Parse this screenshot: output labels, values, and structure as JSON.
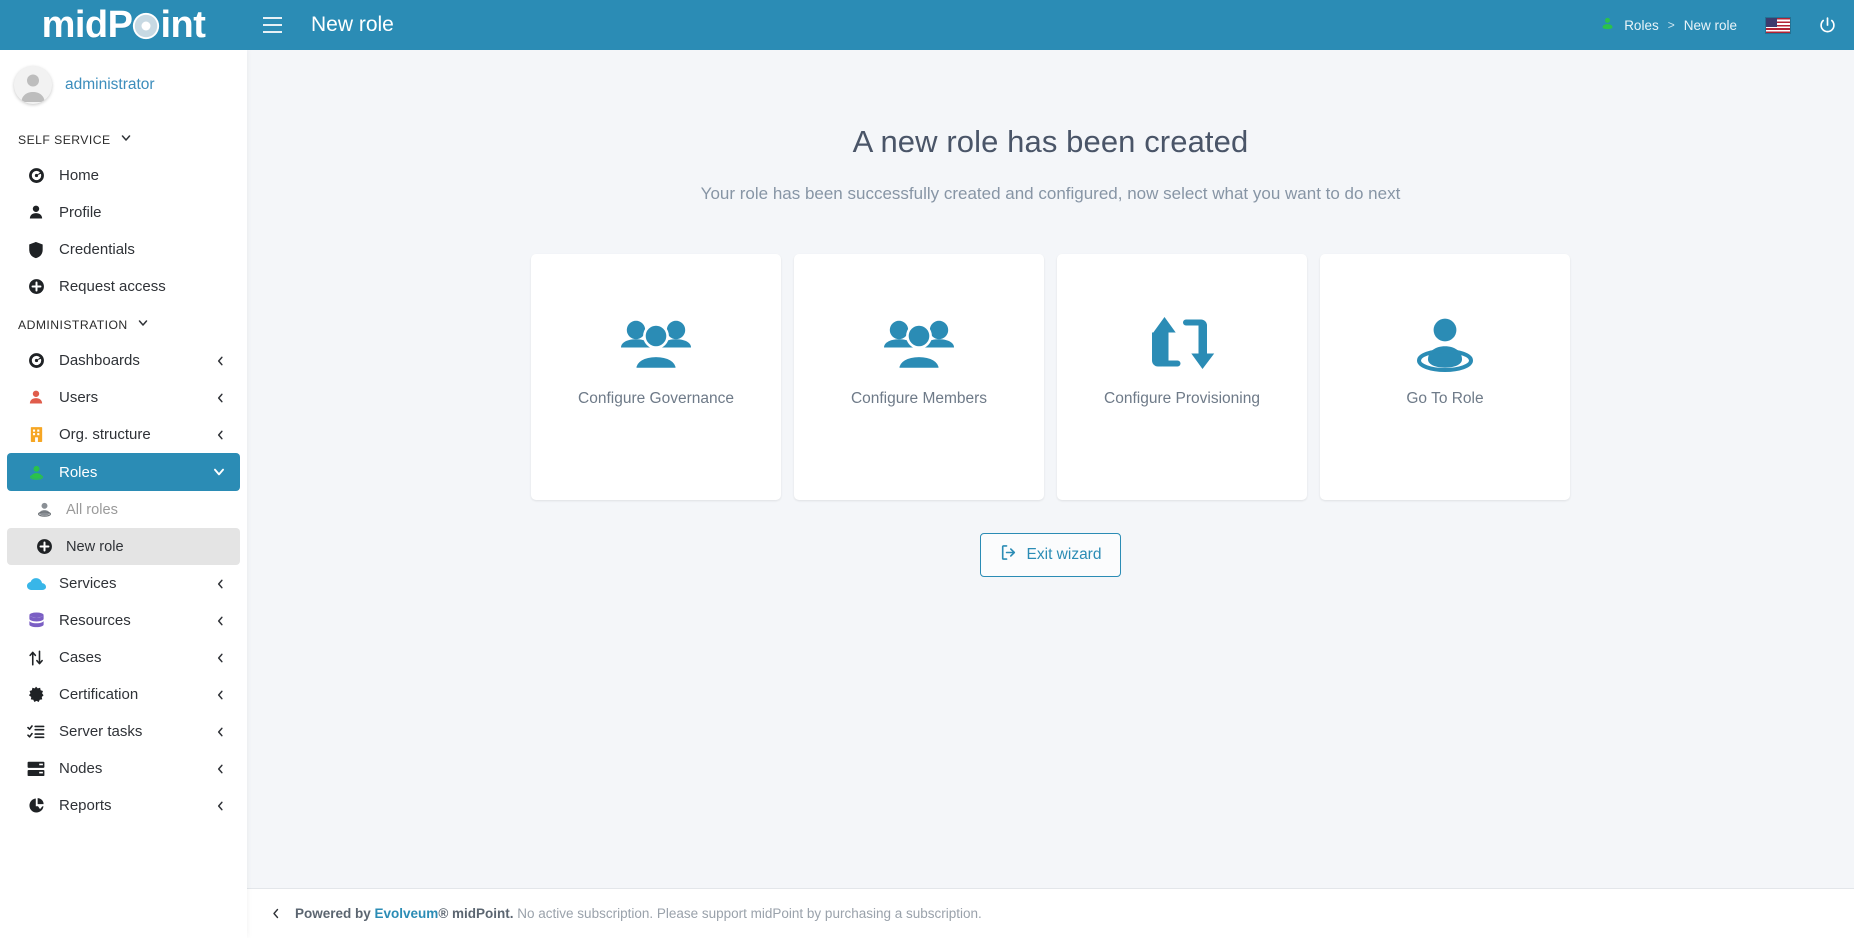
{
  "app": {
    "brand_before": "mid",
    "brand_p": "P",
    "brand_after": "int",
    "page_title": "New role",
    "accent_color": "#2b8cb5"
  },
  "topbar": {
    "menu_icon": "hamburger-icon",
    "breadcrumb": {
      "role_icon": "role-green-icon",
      "items": [
        "Roles",
        "New role"
      ],
      "separator": ">"
    },
    "locale_flag": "us-flag-icon",
    "power_icon": "power-icon"
  },
  "sidebar": {
    "user": {
      "name": "administrator",
      "avatar_icon": "user-avatar-icon"
    },
    "sections": [
      {
        "header": "SELF SERVICE",
        "items": [
          {
            "label": "Home",
            "icon": "dashboard-icon",
            "icon_color": "#1f2225",
            "has_chevron": false
          },
          {
            "label": "Profile",
            "icon": "user-icon",
            "icon_color": "#1f2225",
            "has_chevron": false
          },
          {
            "label": "Credentials",
            "icon": "shield-icon",
            "icon_color": "#1f2225",
            "has_chevron": false
          },
          {
            "label": "Request access",
            "icon": "plus-circle-icon",
            "icon_color": "#1f2225",
            "has_chevron": false
          }
        ]
      },
      {
        "header": "ADMINISTRATION",
        "items": [
          {
            "label": "Dashboards",
            "icon": "dashboard-icon",
            "icon_color": "#1f2225",
            "has_chevron": true
          },
          {
            "label": "Users",
            "icon": "user-red-icon",
            "icon_color": "#e05c4b",
            "has_chevron": true
          },
          {
            "label": "Org. structure",
            "icon": "building-icon",
            "icon_color": "#f6a623",
            "has_chevron": true
          },
          {
            "label": "Roles",
            "icon": "role-green-icon",
            "icon_color": "#2bc24a",
            "has_chevron": true,
            "state": "active"
          },
          {
            "label": "All roles",
            "icon": "role-gray-icon",
            "icon_color": "#8a8f95",
            "has_chevron": false,
            "state": "sub-muted"
          },
          {
            "label": "New role",
            "icon": "plus-circle-icon",
            "icon_color": "#1f2225",
            "has_chevron": false,
            "state": "sub-selected"
          },
          {
            "label": "Services",
            "icon": "cloud-icon",
            "icon_color": "#38b6e8",
            "has_chevron": true
          },
          {
            "label": "Resources",
            "icon": "database-icon",
            "icon_color": "#7b5fc4",
            "has_chevron": true
          },
          {
            "label": "Cases",
            "icon": "arrows-updown-icon",
            "icon_color": "#1f2225",
            "has_chevron": true
          },
          {
            "label": "Certification",
            "icon": "certificate-icon",
            "icon_color": "#1f2225",
            "has_chevron": true
          },
          {
            "label": "Server tasks",
            "icon": "tasks-list-icon",
            "icon_color": "#1f2225",
            "has_chevron": true
          },
          {
            "label": "Nodes",
            "icon": "server-icon",
            "icon_color": "#1f2225",
            "has_chevron": true
          },
          {
            "label": "Reports",
            "icon": "pie-chart-icon",
            "icon_color": "#1f2225",
            "has_chevron": true
          }
        ]
      }
    ]
  },
  "main": {
    "title": "A new role has been created",
    "subtitle": "Your role has been successfully created and configured, now select what you want to do next",
    "cards": [
      {
        "label": "Configure Governance",
        "icon": "users-group-icon"
      },
      {
        "label": "Configure Members",
        "icon": "users-group-icon"
      },
      {
        "label": "Configure Provisioning",
        "icon": "sync-arrows-icon"
      },
      {
        "label": "Go To Role",
        "icon": "role-person-icon"
      }
    ],
    "exit_button": {
      "label": "Exit wizard",
      "icon": "sign-out-icon"
    }
  },
  "footer": {
    "collapse_icon": "chevron-left-icon",
    "powered_by": "Powered by ",
    "company": "Evolveum",
    "registered": "®",
    "product": " midPoint.",
    "notice": "No active subscription. Please support midPoint by purchasing a subscription."
  }
}
